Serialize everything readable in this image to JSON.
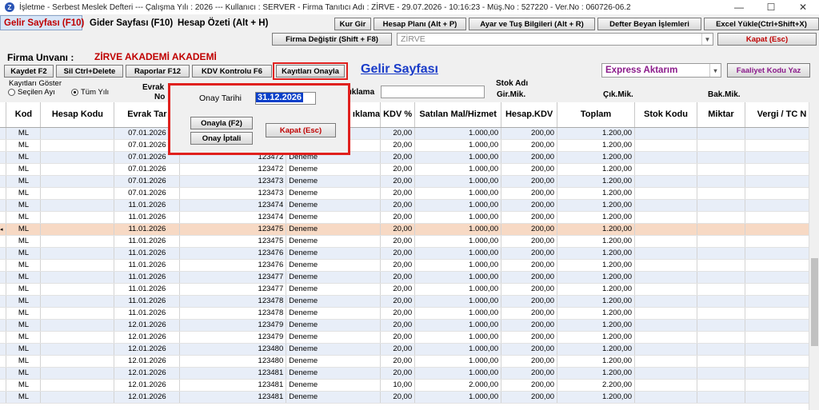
{
  "window": {
    "title": "İşletme - Serbest Meslek Defteri  ---  Çalışma Yılı : 2026  ---  Kullanıcı : SERVER - Firma Tanıtıcı Adı : ZİRVE - 29.07.2026 - 10:16:23 - Müş.No : 527220 - Ver.No : 060726-06.2",
    "app_icon": "Z",
    "minimize": "—",
    "maximize": "☐",
    "close": "✕"
  },
  "tabs": [
    {
      "label": "Gelir Sayfası (F10)"
    },
    {
      "label": "Gider Sayfası (F10)"
    },
    {
      "label": "Hesap Özeti (Alt + H)"
    }
  ],
  "toolbar": {
    "kur_gir": "Kur Gir",
    "hesap_plani": "Hesap Planı (Alt + P)",
    "ayar": "Ayar ve Tuş Bilgileri (Alt + R)",
    "defter_beyan": "Defter Beyan İşlemleri",
    "excel": "Excel Yükle(Ctrl+Shift+X)",
    "firma_degistir": "Firma Değiştir (Shift + F8)",
    "firma_combo": "ZİRVE",
    "kapat": "Kapat (Esc)"
  },
  "firma": {
    "label": "Firma Unvanı :",
    "value": "ZİRVE AKADEMİ AKADEMİ"
  },
  "actions": {
    "kaydet": "Kaydet F2",
    "sil": "Sil Ctrl+Delete",
    "raporlar": "Raporlar F12",
    "kdv": "KDV Kontrolu F6",
    "onayla": "Kayıtları Onayla",
    "page_title": "Gelir Sayfası",
    "express": "Express Aktarım",
    "faaliyet": "Faaliyet Kodu Yaz"
  },
  "filter": {
    "group_label": "Kayıtları Göster",
    "radio1": "Seçilen Ayı",
    "radio2": "Tüm Yılı",
    "evrak_label": "Evrak",
    "no_label": "No",
    "aciklama_label": "ıklama"
  },
  "stock": {
    "stok_adi": "Stok Adı",
    "gir": "Gir.Mik.",
    "cik": "Çık.Mik.",
    "bak": "Bak.Mik."
  },
  "dialog": {
    "onay_tarihi_label": "Onay Tarihi",
    "onay_tarihi_value": "31.12.2026",
    "onayla_btn": "Onayla (F2)",
    "iptal_btn": "Onay İptali",
    "kapat_btn": "Kapat (Esc)"
  },
  "grid": {
    "columns": [
      "Kod",
      "Hesap Kodu",
      "Evrak Tar",
      "",
      "ıklama",
      "KDV %",
      "Satılan Mal/Hizmet",
      "Hesap.KDV",
      "Toplam",
      "Stok Kodu",
      "Miktar",
      "Vergi / TC N"
    ],
    "rows": [
      [
        "ML",
        "",
        "07.01.2026",
        "",
        "",
        "20,00",
        "1.000,00",
        "200,00",
        "1.200,00"
      ],
      [
        "ML",
        "",
        "07.01.2026",
        "",
        "",
        "20,00",
        "1.000,00",
        "200,00",
        "1.200,00"
      ],
      [
        "ML",
        "",
        "07.01.2026",
        "123472",
        "Deneme",
        "20,00",
        "1.000,00",
        "200,00",
        "1.200,00"
      ],
      [
        "ML",
        "",
        "07.01.2026",
        "123472",
        "Deneme",
        "20,00",
        "1.000,00",
        "200,00",
        "1.200,00"
      ],
      [
        "ML",
        "",
        "07.01.2026",
        "123473",
        "Deneme",
        "20,00",
        "1.000,00",
        "200,00",
        "1.200,00"
      ],
      [
        "ML",
        "",
        "07.01.2026",
        "123473",
        "Deneme",
        "20,00",
        "1.000,00",
        "200,00",
        "1.200,00"
      ],
      [
        "ML",
        "",
        "11.01.2026",
        "123474",
        "Deneme",
        "20,00",
        "1.000,00",
        "200,00",
        "1.200,00"
      ],
      [
        "ML",
        "",
        "11.01.2026",
        "123474",
        "Deneme",
        "20,00",
        "1.000,00",
        "200,00",
        "1.200,00"
      ],
      [
        "ML",
        "",
        "11.01.2026",
        "123475",
        "Deneme",
        "20,00",
        "1.000,00",
        "200,00",
        "1.200,00"
      ],
      [
        "ML",
        "",
        "11.01.2026",
        "123475",
        "Deneme",
        "20,00",
        "1.000,00",
        "200,00",
        "1.200,00"
      ],
      [
        "ML",
        "",
        "11.01.2026",
        "123476",
        "Deneme",
        "20,00",
        "1.000,00",
        "200,00",
        "1.200,00"
      ],
      [
        "ML",
        "",
        "11.01.2026",
        "123476",
        "Deneme",
        "20,00",
        "1.000,00",
        "200,00",
        "1.200,00"
      ],
      [
        "ML",
        "",
        "11.01.2026",
        "123477",
        "Deneme",
        "20,00",
        "1.000,00",
        "200,00",
        "1.200,00"
      ],
      [
        "ML",
        "",
        "11.01.2026",
        "123477",
        "Deneme",
        "20,00",
        "1.000,00",
        "200,00",
        "1.200,00"
      ],
      [
        "ML",
        "",
        "11.01.2026",
        "123478",
        "Deneme",
        "20,00",
        "1.000,00",
        "200,00",
        "1.200,00"
      ],
      [
        "ML",
        "",
        "11.01.2026",
        "123478",
        "Deneme",
        "20,00",
        "1.000,00",
        "200,00",
        "1.200,00"
      ],
      [
        "ML",
        "",
        "12.01.2026",
        "123479",
        "Deneme",
        "20,00",
        "1.000,00",
        "200,00",
        "1.200,00"
      ],
      [
        "ML",
        "",
        "12.01.2026",
        "123479",
        "Deneme",
        "20,00",
        "1.000,00",
        "200,00",
        "1.200,00"
      ],
      [
        "ML",
        "",
        "12.01.2026",
        "123480",
        "Deneme",
        "20,00",
        "1.000,00",
        "200,00",
        "1.200,00"
      ],
      [
        "ML",
        "",
        "12.01.2026",
        "123480",
        "Deneme",
        "20,00",
        "1.000,00",
        "200,00",
        "1.200,00"
      ],
      [
        "ML",
        "",
        "12.01.2026",
        "123481",
        "Deneme",
        "20,00",
        "1.000,00",
        "200,00",
        "1.200,00"
      ],
      [
        "ML",
        "",
        "12.01.2026",
        "123481",
        "Deneme",
        "10,00",
        "2.000,00",
        "200,00",
        "2.200,00"
      ],
      [
        "ML",
        "",
        "12.01.2026",
        "123481",
        "Deneme",
        "20,00",
        "1.000,00",
        "200,00",
        "1.200,00"
      ]
    ],
    "selected_row": 8,
    "row_marker": "◂"
  },
  "colors": {
    "accent_red": "#c00000",
    "highlight_box": "#e0201e",
    "title_blue": "#1a3cc9",
    "express_purple": "#8b1a8b"
  }
}
